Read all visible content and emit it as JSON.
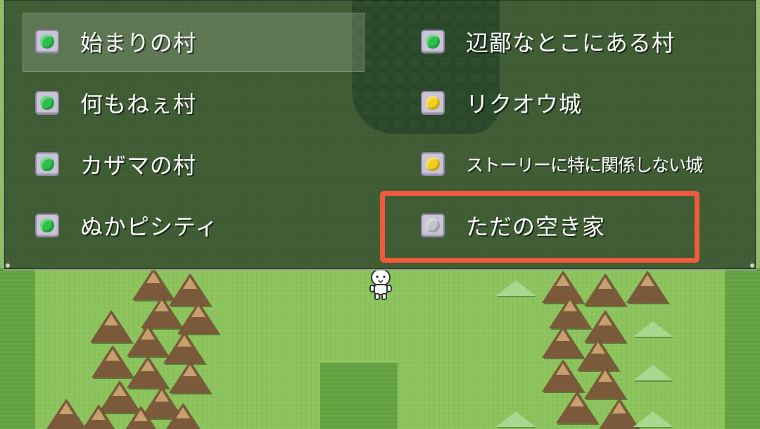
{
  "menu": {
    "title": "",
    "columns": [
      [
        {
          "label": "始まりの村",
          "status": "green"
        },
        {
          "label": "何もねぇ村",
          "status": "green"
        },
        {
          "label": "カザマの村",
          "status": "green"
        },
        {
          "label": "ぬかピシティ",
          "status": "green"
        }
      ],
      [
        {
          "label": "辺鄙なとこにある村",
          "status": "green"
        },
        {
          "label": "リクオウ城",
          "status": "yellow"
        },
        {
          "label": "ストーリーに特に関係しない城",
          "status": "yellow"
        },
        {
          "label": "ただの空き家",
          "status": "gray"
        }
      ]
    ],
    "highlighted_entry": "始まりの村",
    "selected_entry": "ただの空き家"
  },
  "colors": {
    "green": "#2ec04a",
    "yellow": "#f2cf1e",
    "gray": "#c4c4cc",
    "selection_outline": "#f05a3c"
  }
}
